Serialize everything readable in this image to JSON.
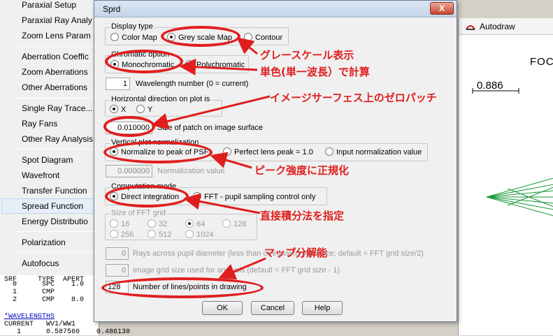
{
  "menu": {
    "items": [
      "Paraxial Setup",
      "Paraxial Ray Analy",
      "Zoom Lens Param",
      "Aberration Coeffic",
      "Zoom Aberrations",
      "Other Aberrations",
      "Single Ray Trace...",
      "Ray Fans",
      "Other Ray Analysis",
      "Spot Diagram",
      "Wavefront",
      "Transfer Function",
      "Spread Function",
      "Energy Distributio",
      "Polarization",
      "Autofocus"
    ],
    "highlighted": "Spread Function"
  },
  "textwin": {
    "header": "SRF     TYPE  APERT",
    "rows": [
      "  0      SPC    1.0",
      "  1      CMP    ",
      "  2      CMP    8.0"
    ],
    "link": "*WAVELENGTHS",
    "current": "CURRENT   WV1/WW1",
    "row1": "   1      0.587560    0.486130"
  },
  "autodraw": {
    "title": "Autodraw",
    "foca_label": "FOCA",
    "scale_label": "0.886"
  },
  "dialog": {
    "title": "Sprd",
    "close_label": "X",
    "display_type": {
      "label": "Display type",
      "options": [
        "Color Map",
        "Grey scale Map",
        "Contour"
      ],
      "selected": "Grey scale Map"
    },
    "chromatic": {
      "label": "Chromatic option",
      "options": [
        "Monochromatic",
        "Polychromatic"
      ],
      "selected": "Monochromatic"
    },
    "wavelength": {
      "value": "1",
      "label": "Wavelength number (0 = current)"
    },
    "horizontal": {
      "label": "Horizontal direction on plot is",
      "options": [
        "X",
        "Y"
      ],
      "selected": "X"
    },
    "patch": {
      "value": "0.010000",
      "label": "Size of patch on image surface"
    },
    "vertical": {
      "label": "Vertical plot normalization",
      "options": [
        "Normalize to peak of PSF",
        "Perfect lens peak = 1.0",
        "Input normalization value"
      ],
      "selected": "Normalize to peak of PSF"
    },
    "norm_value": {
      "value": "0.000000",
      "label": "Normalization value"
    },
    "computation": {
      "label": "Computation mode",
      "options": [
        "Direct integration",
        "FFT - pupil sampling control only"
      ],
      "selected": "Direct integration"
    },
    "fft_grid": {
      "label": "Size of FFT grid",
      "options": [
        "16",
        "32",
        "64",
        "128",
        "256",
        "512",
        "1024"
      ],
      "selected": "64"
    },
    "rays": {
      "value": "0",
      "label": "Rays across pupil diameter (less than or equal to pupil size; default = FFT grid size/2)"
    },
    "image_grid": {
      "value": "0",
      "label": "Image grid size used for analysis (default = FFT grid size - 1)"
    },
    "lines": {
      "value": "128",
      "label": "Number of lines/points in drawing"
    },
    "buttons": {
      "ok": "OK",
      "cancel": "Cancel",
      "help": "Help"
    }
  },
  "annotations": {
    "grey_scale": "グレースケール表示",
    "mono": "単色(単一波長）で計算",
    "zero_patch": "イメージサーフェス上のゼロパッチ",
    "peak": "ピーク強度に正規化",
    "direct": "直接積分法を指定",
    "map_resolution": "マップ分解能"
  },
  "colors": {
    "annotation": "#e01e1e",
    "ray_green": "#1a9a3a"
  }
}
